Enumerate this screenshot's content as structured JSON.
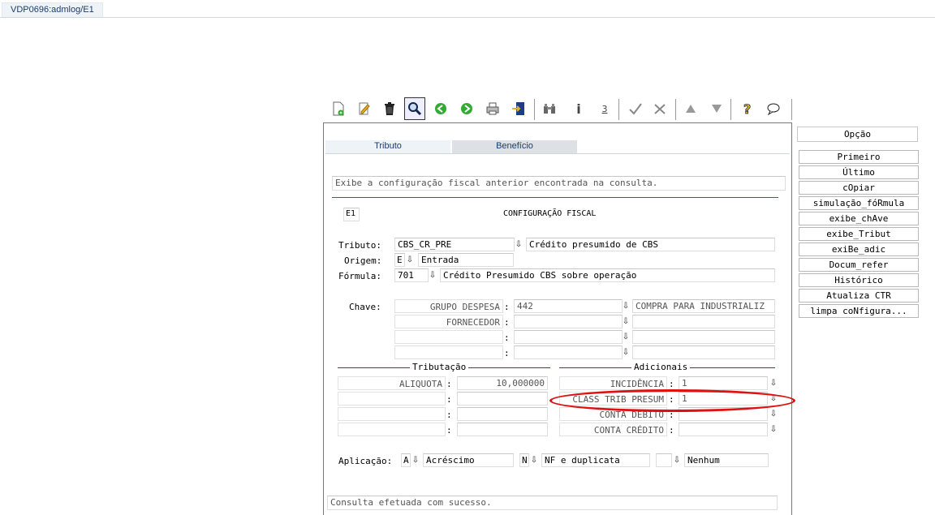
{
  "window": {
    "tab_label": "VDP0696:admlog/E1"
  },
  "toolbar": {
    "items": [
      "new-icon",
      "edit-icon",
      "delete-icon",
      "search-icon",
      "previous-icon",
      "next-icon",
      "print-icon",
      "exit-icon",
      "binoculars-icon",
      "info-icon",
      "number-icon",
      "confirm-icon",
      "cancel-icon",
      "up-icon",
      "down-icon",
      "help-icon",
      "comment-icon"
    ]
  },
  "panel": {
    "tabs": [
      {
        "label": "Tributo"
      },
      {
        "label": "Benefício"
      }
    ],
    "info_text": "Exibe a configuração fiscal anterior encontrada na consulta.",
    "empresa": "E1",
    "title": "CONFIGURAÇÃO FISCAL",
    "tributo": {
      "label": "Tributo:",
      "code": "CBS_CR_PRE",
      "desc": "Crédito presumido de CBS"
    },
    "origem": {
      "label": "Origem:",
      "code": "E",
      "desc": "Entrada"
    },
    "formula": {
      "label": "Fórmula:",
      "code": "701",
      "desc": "Crédito Presumido CBS sobre operação"
    },
    "chave": {
      "label": "Chave:",
      "rows": [
        {
          "name": "GRUPO DESPESA",
          "value": "442",
          "desc": "COMPRA PARA INDUSTRIALIZ"
        },
        {
          "name": "FORNECEDOR",
          "value": "",
          "desc": ""
        },
        {
          "name": "",
          "value": "",
          "desc": ""
        },
        {
          "name": "",
          "value": "",
          "desc": ""
        }
      ]
    },
    "tributacao": {
      "title": "Tributação",
      "rows": [
        {
          "name": "ALIQUOTA",
          "value": "10,000000"
        },
        {
          "name": "",
          "value": ""
        },
        {
          "name": "",
          "value": ""
        },
        {
          "name": "",
          "value": ""
        }
      ]
    },
    "adicionais": {
      "title": "Adicionais",
      "rows": [
        {
          "name": "INCIDÊNCIA",
          "value": "1"
        },
        {
          "name": "CLASS TRIB PRESUM",
          "value": "1"
        },
        {
          "name": "CONTA DÉBITO",
          "value": ""
        },
        {
          "name": "CONTA CRÉDITO",
          "value": ""
        }
      ]
    },
    "aplicacao": {
      "label": "Aplicação:",
      "code1": "A",
      "desc1": "Acréscimo",
      "code2": "N",
      "desc2": "NF e duplicata",
      "code3": "",
      "desc3": "Nenhum"
    },
    "status": "Consulta efetuada com sucesso."
  },
  "sidebar": {
    "header": "Opção",
    "buttons": [
      "Primeiro",
      "Último",
      "cOpiar",
      "simulação_fóRmula",
      "exibe_chAve",
      "exibe_Tribut",
      "exiBe_adic",
      "Docum_refer",
      "Histórico",
      "Atualiza CTR",
      "limpa coNfigura..."
    ]
  },
  "colors": {
    "accent_red": "#e01010",
    "tab_bg": "#eef3f8",
    "tab_text": "#1d3b66"
  }
}
